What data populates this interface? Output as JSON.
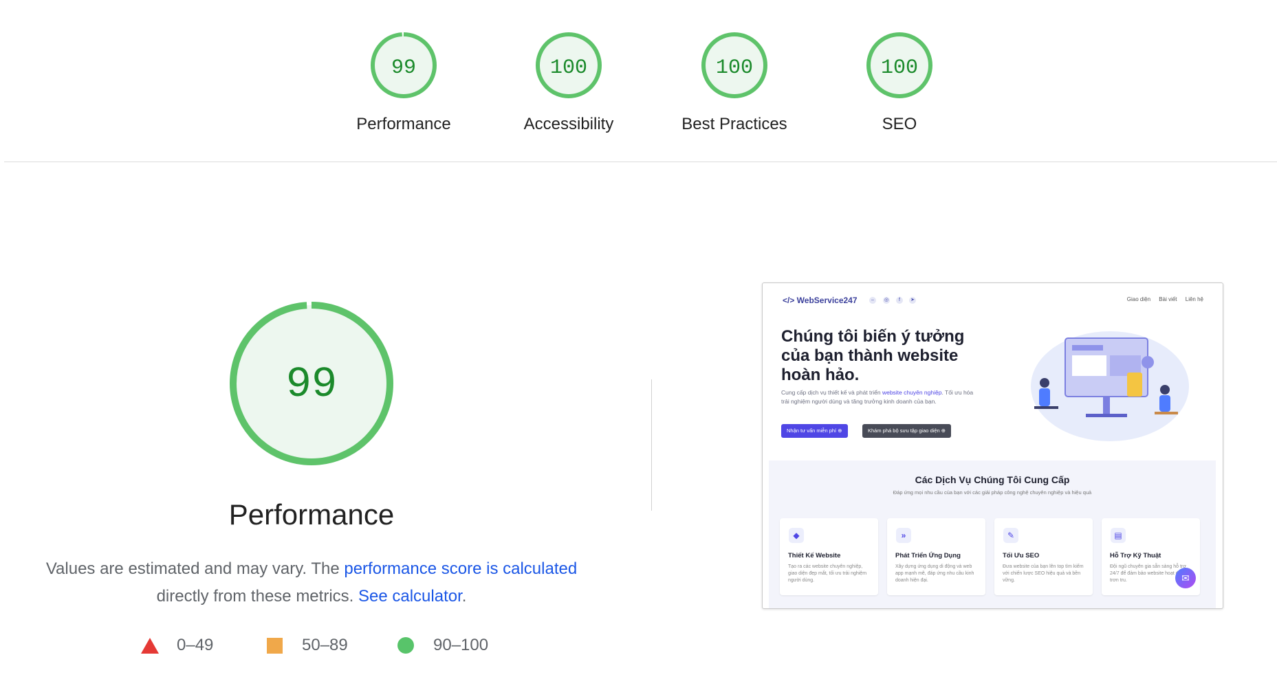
{
  "summary": {
    "gauges": [
      {
        "score": "99",
        "label": "Performance",
        "fraction": 0.99
      },
      {
        "score": "100",
        "label": "Accessibility",
        "fraction": 1.0
      },
      {
        "score": "100",
        "label": "Best Practices",
        "fraction": 1.0
      },
      {
        "score": "100",
        "label": "SEO",
        "fraction": 1.0
      }
    ]
  },
  "colors": {
    "pass": "#5ec36a",
    "pass_fill": "#edf7ef",
    "pass_text": "#1b8a2b",
    "fail": "#e53935",
    "average": "#f0a84a",
    "link": "#1a56e6"
  },
  "detail": {
    "score": "99",
    "fraction": 0.99,
    "title": "Performance",
    "desc_prefix": "Values are estimated and may vary. The ",
    "desc_link": "performance score is calculated",
    "desc_mid": " directly from these metrics. ",
    "desc_link2": "See calculator",
    "desc_suffix": "."
  },
  "legend": [
    {
      "icon": "triangle-icon",
      "range": "0–49"
    },
    {
      "icon": "square-icon",
      "range": "50–89"
    },
    {
      "icon": "circle-icon",
      "range": "90–100"
    }
  ],
  "screenshot": {
    "logo": "</> WebService247",
    "nav_links": [
      "Giao diện",
      "Bài viết",
      "Liên hệ"
    ],
    "hero_title": "Chúng tôi biến ý tưởng của bạn thành website hoàn hảo.",
    "hero_sub_prefix": "Cung cấp dịch vụ thiết kế và phát triển ",
    "hero_sub_link": "website chuyên nghiệp",
    "hero_sub_suffix": ". Tối ưu hóa trải nghiệm người dùng và tăng trưởng kinh doanh của bạn.",
    "button_primary": "Nhận tư vấn miễn phí ⊕",
    "button_secondary": "Khám phá bộ sưu tập giao diện ⊕",
    "services_title": "Các Dịch Vụ Chúng Tôi Cung Cấp",
    "services_sub": "Đáp ứng mọi nhu cầu của bạn với các giải pháp công nghệ chuyên nghiệp và hiệu quả",
    "cards": [
      {
        "icon": "shapes-icon",
        "glyph": "◆",
        "title": "Thiết Kế Website",
        "desc": "Tạo ra các website chuyên nghiệp, giao diện đẹp mắt, tối ưu trải nghiệm người dùng."
      },
      {
        "icon": "chevrons-icon",
        "glyph": "»",
        "title": "Phát Triển Ứng Dụng",
        "desc": "Xây dựng ứng dụng di động và web app mạnh mẽ, đáp ứng nhu cầu kinh doanh hiện đại."
      },
      {
        "icon": "wrench-icon",
        "glyph": "✎",
        "title": "Tối Ưu SEO",
        "desc": "Đưa website của bạn lên top tìm kiếm với chiến lược SEO hiệu quả và bền vững."
      },
      {
        "icon": "book-icon",
        "glyph": "▤",
        "title": "Hỗ Trợ Kỹ Thuật",
        "desc": "Đội ngũ chuyên gia sẵn sàng hỗ trợ 24/7 để đảm bảo website hoạt động trơn tru."
      }
    ]
  }
}
